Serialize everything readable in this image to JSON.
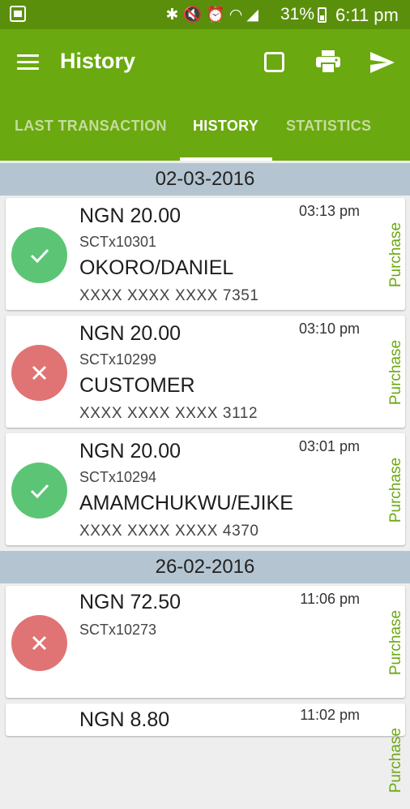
{
  "status_bar": {
    "icons": [
      "image-icon",
      "bluetooth-icon",
      "mute-icon",
      "alarm-icon",
      "wifi-icon",
      "signal-icon",
      "battery-icon"
    ],
    "battery": "31%",
    "time": "6:11 pm"
  },
  "app_bar": {
    "title": "History",
    "color": "#6aa90f"
  },
  "tabs": [
    {
      "label": "LAST TRANSACTION",
      "active": false
    },
    {
      "label": "HISTORY",
      "active": true
    },
    {
      "label": "STATISTICS",
      "active": false
    }
  ],
  "groups": [
    {
      "date": "02-03-2016",
      "transactions": [
        {
          "amount": "NGN 20.00",
          "time": "03:13 pm",
          "ref": "SCTx10301",
          "name": "OKORO/DANIEL",
          "pan": "XXXX XXXX XXXX 7351",
          "type": "Purchase",
          "status": "success"
        },
        {
          "amount": "NGN 20.00",
          "time": "03:10 pm",
          "ref": "SCTx10299",
          "name": "CUSTOMER",
          "pan": "XXXX XXXX XXXX 3112",
          "type": "Purchase",
          "status": "failed"
        },
        {
          "amount": "NGN 20.00",
          "time": "03:01 pm",
          "ref": "SCTx10294",
          "name": "AMAMCHUKWU/EJIKE",
          "pan": "XXXX XXXX XXXX 4370",
          "type": "Purchase",
          "status": "success"
        }
      ]
    },
    {
      "date": "26-02-2016",
      "transactions": [
        {
          "amount": "NGN 72.50",
          "time": "11:06 pm",
          "ref": "SCTx10273",
          "type": "Purchase",
          "status": "failed"
        },
        {
          "amount": "NGN 8.80",
          "time": "11:02 pm",
          "type": "Purchase"
        }
      ]
    }
  ]
}
